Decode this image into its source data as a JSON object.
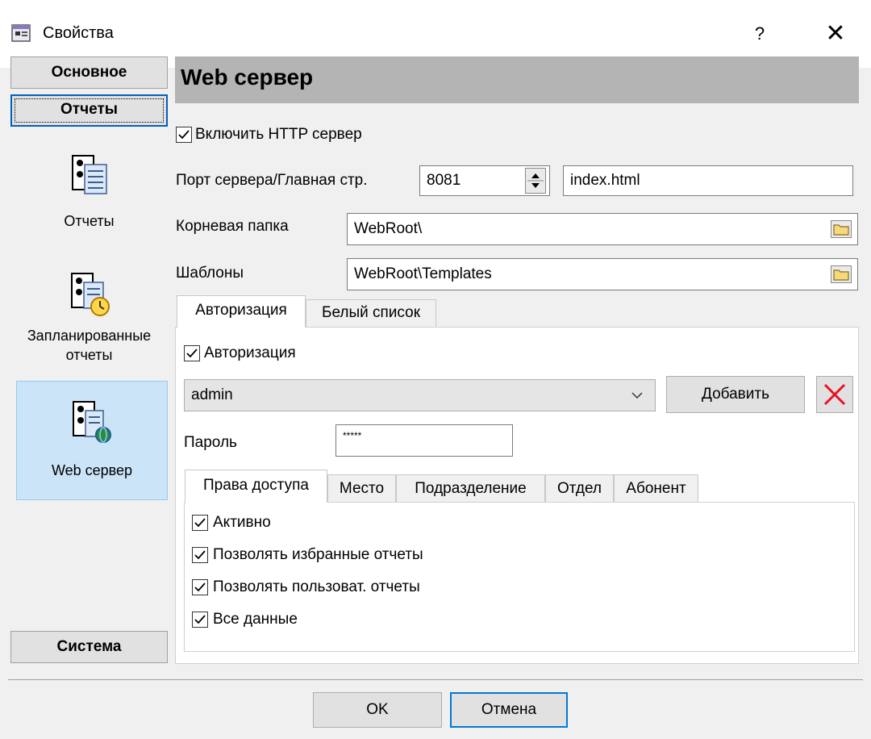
{
  "window": {
    "title": "Свойства",
    "help_label": "?",
    "close_label": "✕"
  },
  "nav": {
    "top_buttons": [
      "Основное",
      "Отчеты"
    ],
    "items": [
      {
        "label_lines": [
          "Отчеты"
        ],
        "icon": "reports-icon"
      },
      {
        "label_lines": [
          "Запланированные",
          "отчеты"
        ],
        "icon": "scheduled-reports-icon"
      },
      {
        "label_lines": [
          "Web сервер"
        ],
        "icon": "web-server-icon",
        "selected": true
      }
    ],
    "bottom_button": "Система"
  },
  "section": {
    "title": "Web сервер"
  },
  "http": {
    "enable_label": "Включить HTTP сервер",
    "enabled": true
  },
  "port": {
    "label": "Порт сервера/Главная стр.",
    "value": "8081",
    "main_page": "index.html"
  },
  "root_folder": {
    "label": "Корневая папка",
    "value": "WebRoot\\"
  },
  "templates": {
    "label": "Шаблоны",
    "value": "WebRoot\\Templates"
  },
  "tabs": {
    "items": [
      "Авторизация",
      "Белый список"
    ],
    "active": "Авторизация"
  },
  "auth": {
    "checkbox_label": "Авторизация",
    "enabled": true,
    "user_selected": "admin",
    "add_label": "Добавить",
    "password_label": "Пароль",
    "password_value": "*****"
  },
  "subtabs": {
    "items": [
      "Права доступа",
      "Место",
      "Подразделение",
      "Отдел",
      "Абонент"
    ],
    "active": "Права доступа"
  },
  "permissions": [
    {
      "label": "Активно",
      "checked": true
    },
    {
      "label": "Позволять избранные отчеты",
      "checked": true
    },
    {
      "label": "Позволять пользоват. отчеты",
      "checked": true
    },
    {
      "label": "Все данные",
      "checked": true
    }
  ],
  "footer": {
    "ok_label": "OK",
    "cancel_label": "Отмена"
  },
  "colors": {
    "accent": "#0060c0",
    "selected_bg": "#cce4f7",
    "header_bg": "#b4b4b4",
    "delete_red": "#e81123"
  }
}
